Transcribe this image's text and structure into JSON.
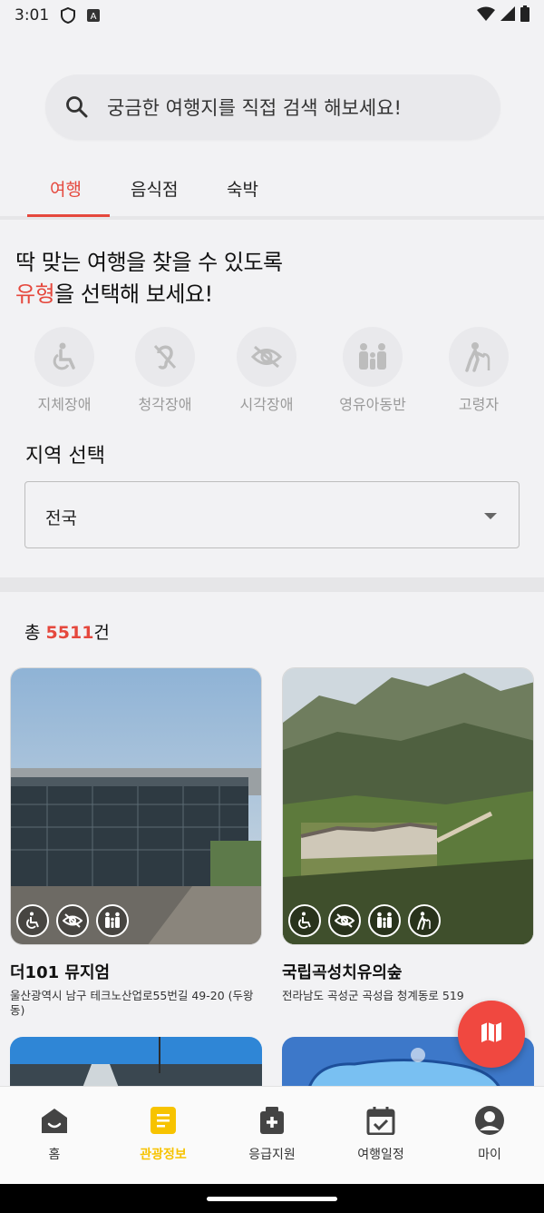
{
  "status_bar": {
    "time": "3:01"
  },
  "search": {
    "placeholder": "궁금한 여행지를 직접 검색 해보세요!"
  },
  "tabs": [
    {
      "label": "여행",
      "active": true
    },
    {
      "label": "음식점",
      "active": false
    },
    {
      "label": "숙박",
      "active": false
    }
  ],
  "heading": {
    "line1": "딱 맞는 여행을 찾을 수 있도록",
    "accent": "유형",
    "line2_rest": "을 선택해 보세요!"
  },
  "types": [
    {
      "label": "지체장애",
      "icon": "wheelchair-icon"
    },
    {
      "label": "청각장애",
      "icon": "ear-off-icon"
    },
    {
      "label": "시각장애",
      "icon": "eye-off-icon"
    },
    {
      "label": "영유아동반",
      "icon": "family-icon"
    },
    {
      "label": "고령자",
      "icon": "elderly-icon"
    }
  ],
  "region": {
    "title": "지역 선택",
    "selected": "전국"
  },
  "results": {
    "prefix": "총 ",
    "count": "5511",
    "suffix": "건"
  },
  "cards": [
    {
      "name": "더101 뮤지엄",
      "address": "울산광역시 남구 테크노산업로55번길 49-20 (두왕동)",
      "badges": [
        "wheelchair-icon",
        "eye-off-icon",
        "family-icon"
      ]
    },
    {
      "name": "국립곡성치유의숲",
      "address": "전라남도 곡성군 곡성읍 청계동로 519",
      "badges": [
        "wheelchair-icon",
        "eye-off-icon",
        "family-icon",
        "elderly-icon"
      ]
    }
  ],
  "bottom_nav": [
    {
      "label": "홈",
      "icon": "home-icon",
      "active": false
    },
    {
      "label": "관광정보",
      "icon": "info-doc-icon",
      "active": true
    },
    {
      "label": "응급지원",
      "icon": "medical-kit-icon",
      "active": false
    },
    {
      "label": "여행일정",
      "icon": "calendar-check-icon",
      "active": false
    },
    {
      "label": "마이",
      "icon": "account-icon",
      "active": false
    }
  ],
  "colors": {
    "accent": "#e5483d",
    "nav_active": "#f7c300",
    "fab": "#f04840"
  }
}
